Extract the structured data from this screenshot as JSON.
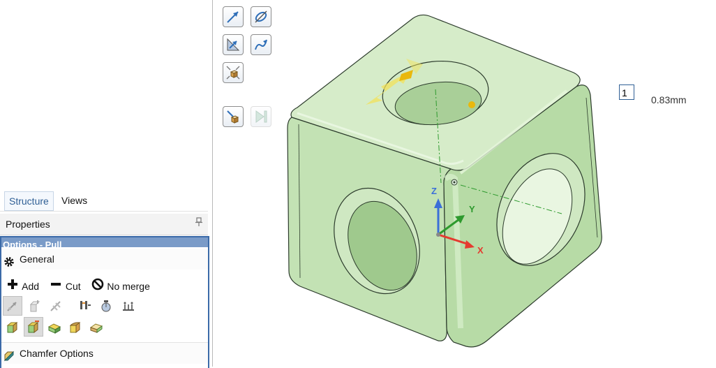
{
  "tabs": [
    {
      "label": "Structure",
      "active": true
    },
    {
      "label": "Views",
      "active": false
    }
  ],
  "properties": {
    "title": "Properties",
    "pin_icon": "pin-icon"
  },
  "options": {
    "header": "Options - Pull",
    "general_label": "General",
    "merge": [
      {
        "label": "Add",
        "icon": "plus-icon"
      },
      {
        "label": "Cut",
        "icon": "minus-icon"
      },
      {
        "label": "No merge",
        "icon": "no-merge-icon"
      }
    ],
    "chamfer_label": "Chamfer Options"
  },
  "viewport": {
    "input_value": "1",
    "dimension": "0.83mm",
    "axes": {
      "x": "X",
      "y": "Y",
      "z": "Z"
    },
    "colors": {
      "model": "#cfe8c4",
      "edge": "#2c3b2c",
      "x_axis": "#e53a2f",
      "y_axis": "#2e9a2e",
      "z_axis": "#3b6fd8",
      "handle": "#f2d23b"
    }
  }
}
